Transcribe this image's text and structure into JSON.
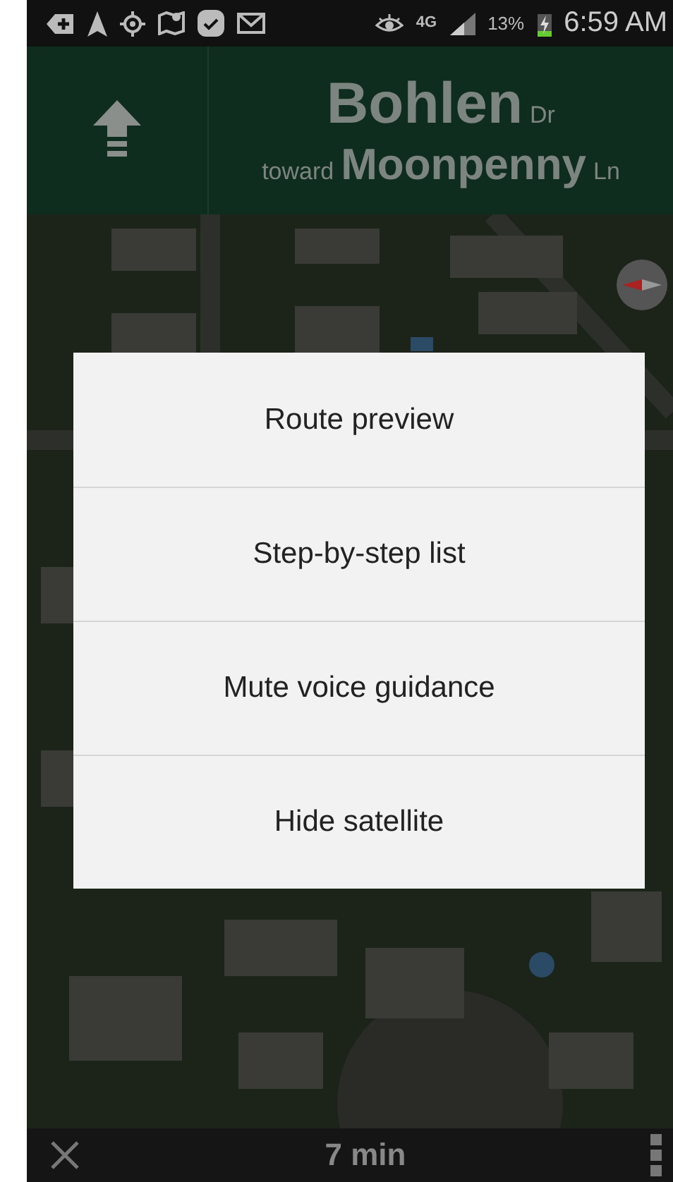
{
  "status_bar": {
    "network": "4G",
    "battery": "13%",
    "time": "6:59 AM"
  },
  "direction": {
    "street": "Bohlen",
    "street_suffix": "Dr",
    "toward": "toward",
    "destination": "Moonpenny",
    "destination_suffix": "Ln"
  },
  "menu": {
    "items": [
      {
        "label": "Route preview"
      },
      {
        "label": "Step-by-step list"
      },
      {
        "label": "Mute voice guidance"
      },
      {
        "label": "Hide satellite"
      }
    ]
  },
  "bottom_bar": {
    "eta": "7 min"
  }
}
